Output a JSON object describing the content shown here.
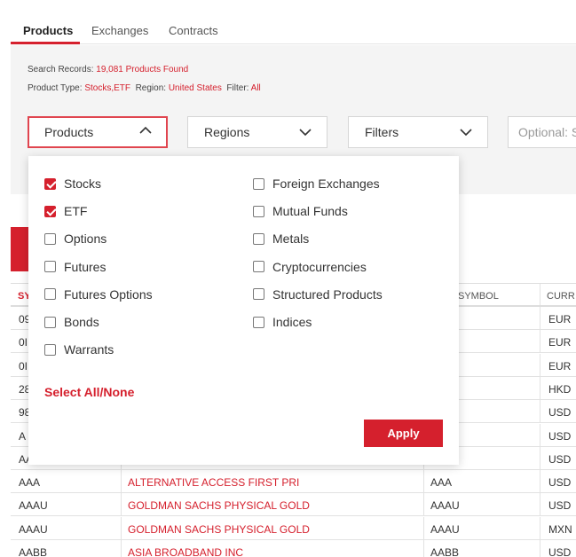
{
  "tabs": [
    {
      "label": "Products",
      "active": true
    },
    {
      "label": "Exchanges",
      "active": false
    },
    {
      "label": "Contracts",
      "active": false
    }
  ],
  "search_info": {
    "records_label": "Search Records:",
    "records_value": "19,081 Products Found",
    "type_label": "Product Type:",
    "type_value": "Stocks,ETF",
    "region_label": "Region:",
    "region_value": "United States",
    "filter_label": "Filter:",
    "filter_value": "All"
  },
  "controls": {
    "products_label": "Products",
    "regions_label": "Regions",
    "filters_label": "Filters",
    "search_placeholder": "Optional: S"
  },
  "dropdown": {
    "left_options": [
      {
        "label": "Stocks",
        "checked": true
      },
      {
        "label": "ETF",
        "checked": true
      },
      {
        "label": "Options",
        "checked": false
      },
      {
        "label": "Futures",
        "checked": false
      },
      {
        "label": "Futures Options",
        "checked": false
      },
      {
        "label": "Bonds",
        "checked": false
      },
      {
        "label": "Warrants",
        "checked": false
      }
    ],
    "right_options": [
      {
        "label": "Foreign Exchanges",
        "checked": false
      },
      {
        "label": "Mutual Funds",
        "checked": false
      },
      {
        "label": "Metals",
        "checked": false
      },
      {
        "label": "Cryptocurrencies",
        "checked": false
      },
      {
        "label": "Structured Products",
        "checked": false
      },
      {
        "label": "Indices",
        "checked": false
      }
    ],
    "select_all_label": "Select All/None",
    "apply_label": "Apply"
  },
  "table": {
    "headers": {
      "symbol": "SY",
      "ib_symbol": "SYMBOL",
      "currency": "CURR"
    },
    "rows": [
      {
        "c1": "09",
        "c2": "",
        "c3": "",
        "c4": "EUR"
      },
      {
        "c1": "0I",
        "c2": "",
        "c3": "",
        "c4": "EUR"
      },
      {
        "c1": "0I",
        "c2": "",
        "c3": "",
        "c4": "EUR"
      },
      {
        "c1": "28",
        "c2": "",
        "c3": "",
        "c4": "HKD"
      },
      {
        "c1": "98",
        "c2": "",
        "c3": "",
        "c4": "USD"
      },
      {
        "c1": "A",
        "c2": "",
        "c3": "",
        "c4": "USD"
      },
      {
        "c1": "AA",
        "c2": "",
        "c3": "",
        "c4": "USD"
      },
      {
        "c1": "AAA",
        "c2": "ALTERNATIVE ACCESS FIRST PRI",
        "c3": "AAA",
        "c4": "USD"
      },
      {
        "c1": "AAAU",
        "c2": "GOLDMAN SACHS PHYSICAL GOLD",
        "c3": "AAAU",
        "c4": "USD"
      },
      {
        "c1": "AAAU",
        "c2": "GOLDMAN SACHS PHYSICAL GOLD",
        "c3": "AAAU",
        "c4": "MXN"
      },
      {
        "c1": "AABB",
        "c2": "ASIA BROADBAND INC",
        "c3": "AABB",
        "c4": "USD"
      }
    ]
  },
  "colors": {
    "accent": "#d5202d"
  }
}
